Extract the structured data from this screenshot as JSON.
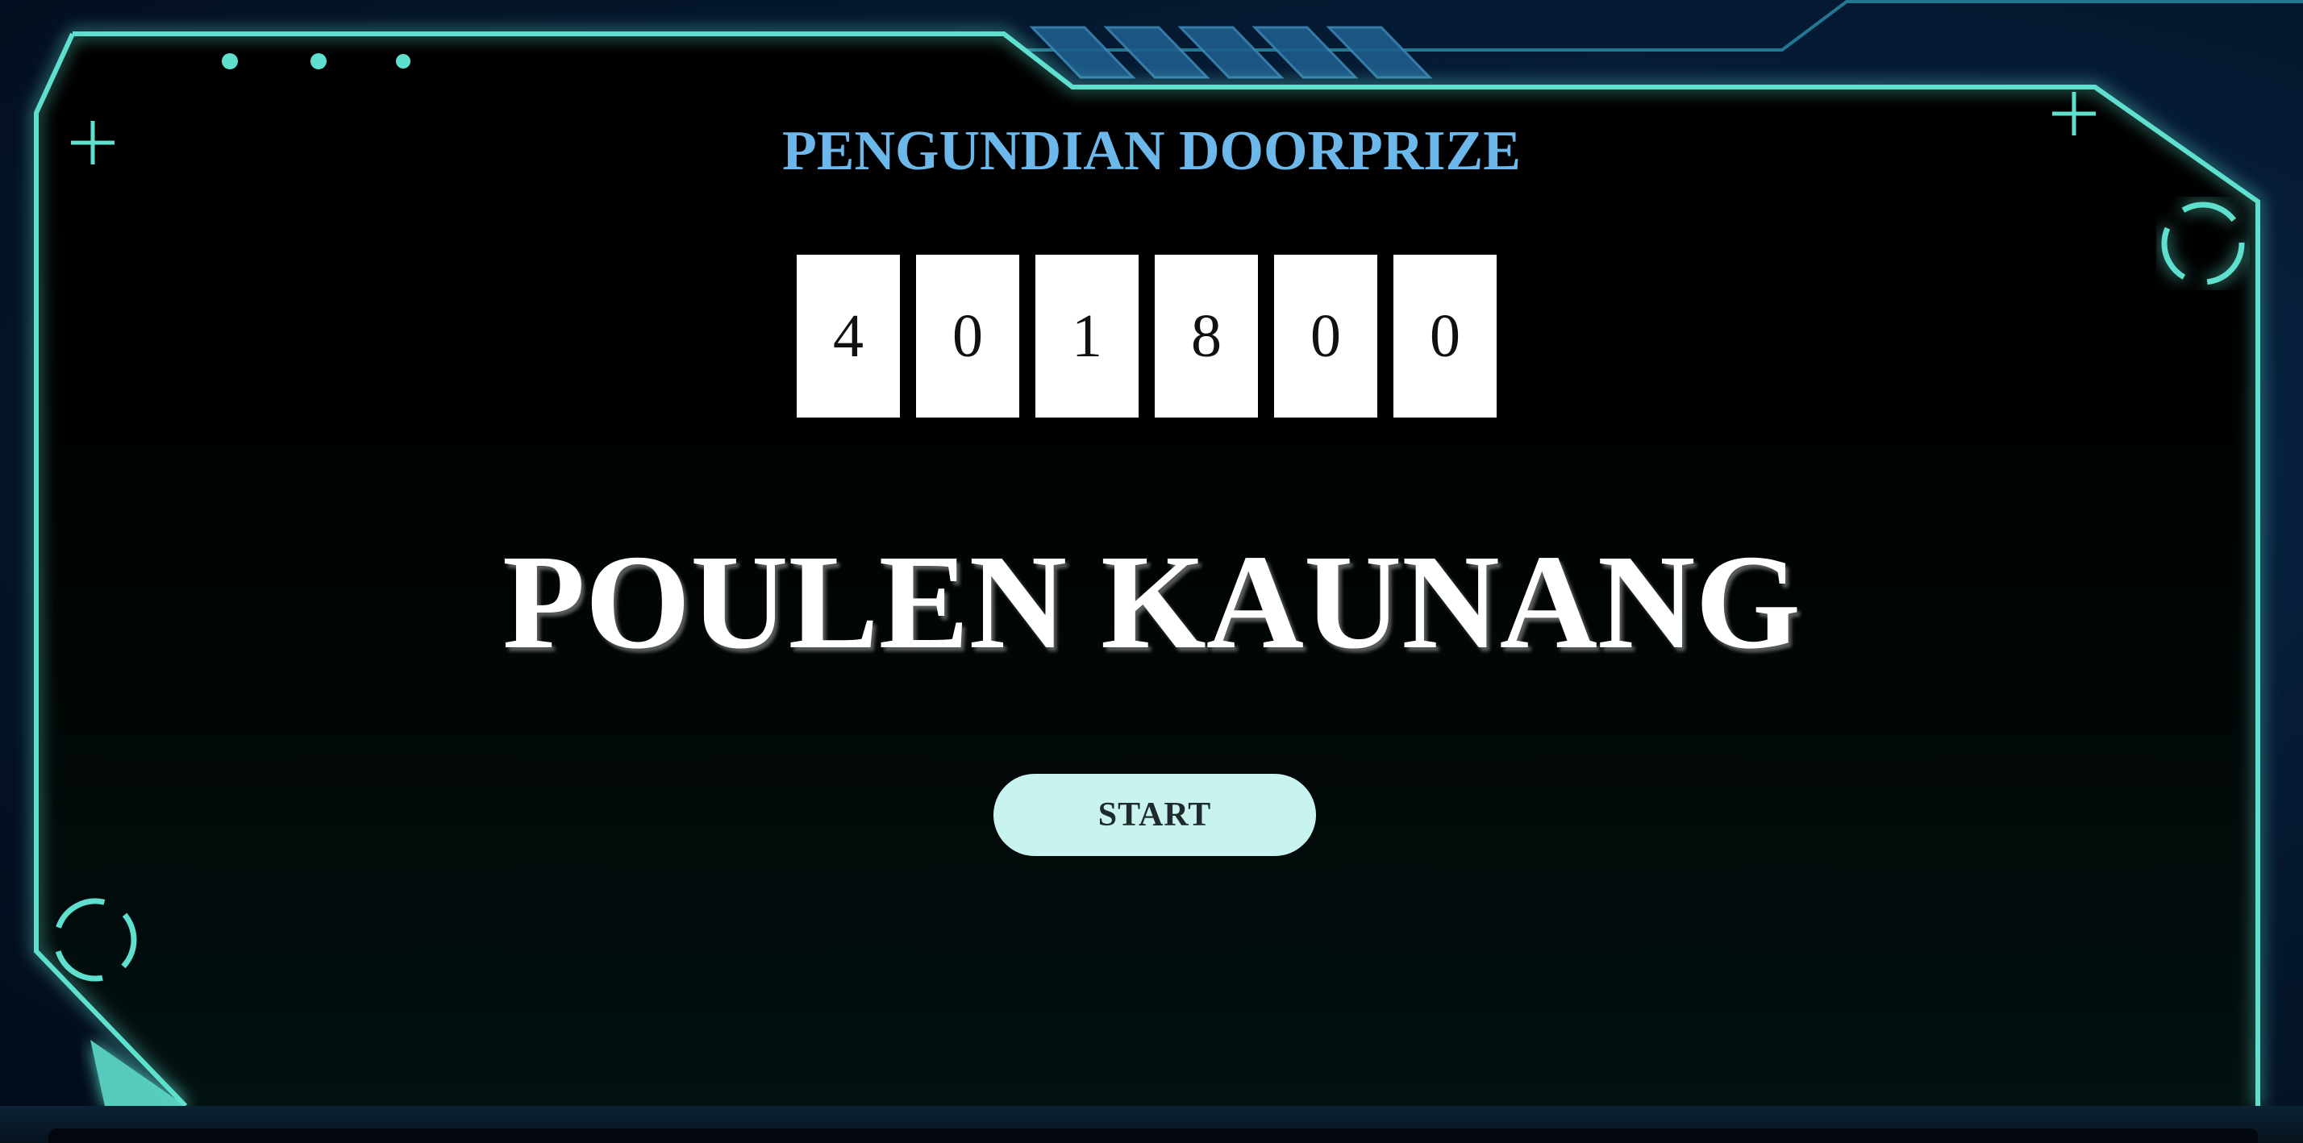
{
  "title": "PENGUNDIAN DOORPRIZE",
  "draw_number": [
    "4",
    "0",
    "1",
    "8",
    "0",
    "0"
  ],
  "winner_name": "POULEN KAUNANG",
  "start_button_label": "START",
  "colors": {
    "frame_accent": "#5fe0cf",
    "title": "#6cb8ea",
    "panel_background": "#000000",
    "button_background": "#c8f3ee",
    "page_background": "#051a33"
  }
}
